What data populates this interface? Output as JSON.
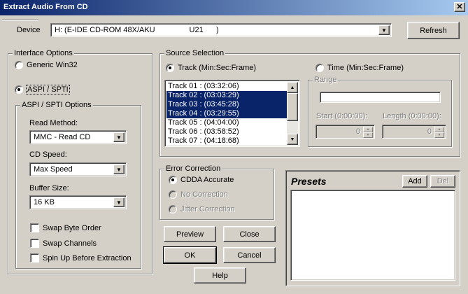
{
  "window": {
    "title": "Extract Audio From CD",
    "close_glyph": "✕"
  },
  "device": {
    "label": "Device",
    "value": "H: (E-IDE CD-ROM 48X/AKU                U21      )",
    "refresh_label": "Refresh"
  },
  "interface_options": {
    "label": "Interface Options",
    "generic_label": "Generic Win32",
    "aspi_label": "ASPI / SPTI",
    "selected": "ASPI / SPTI",
    "aspi_group": {
      "label": "ASPI / SPTI Options",
      "read_method_label": "Read Method:",
      "read_method_value": "MMC - Read CD",
      "cd_speed_label": "CD Speed:",
      "cd_speed_value": "Max Speed",
      "buffer_size_label": "Buffer Size:",
      "buffer_size_value": "16 KB",
      "swap_byte_order": "Swap Byte Order",
      "swap_channels": "Swap Channels",
      "spin_up": "Spin Up Before Extraction"
    }
  },
  "source_selection": {
    "label": "Source Selection",
    "track_radio": "Track (Min:Sec:Frame)",
    "time_radio": "Time (Min:Sec:Frame)",
    "selected": "Track (Min:Sec:Frame)",
    "tracks": [
      {
        "label": "Track 01 : (03:32:06)",
        "selected": false
      },
      {
        "label": "Track 02 : (03:03:29)",
        "selected": true
      },
      {
        "label": "Track 03 : (03:45:28)",
        "selected": true
      },
      {
        "label": "Track 04 : (03:29:55)",
        "selected": true
      },
      {
        "label": "Track 05 : (04:04:00)",
        "selected": false
      },
      {
        "label": "Track 06 : (03:58:52)",
        "selected": false
      },
      {
        "label": "Track 07 : (04:18:68)",
        "selected": false
      }
    ],
    "range": {
      "label": "Range",
      "start_label": "Start (0:00:00):",
      "start_value": "0",
      "length_label": "Length (0:00:00):",
      "length_value": "0"
    }
  },
  "error_correction": {
    "label": "Error Correction",
    "cdda_accurate": "CDDA Accurate",
    "no_correction": "No Correction",
    "jitter_correction": "Jitter Correction",
    "selected": "CDDA Accurate"
  },
  "buttons": {
    "preview": "Preview",
    "close": "Close",
    "ok": "OK",
    "cancel": "Cancel",
    "help": "Help"
  },
  "presets": {
    "title": "Presets",
    "add_label": "Add",
    "del_label": "Del"
  },
  "icons": {
    "dropdown": "chevron-down-icon",
    "scroll_up": "scroll-up-icon",
    "scroll_down": "scroll-down-icon"
  }
}
